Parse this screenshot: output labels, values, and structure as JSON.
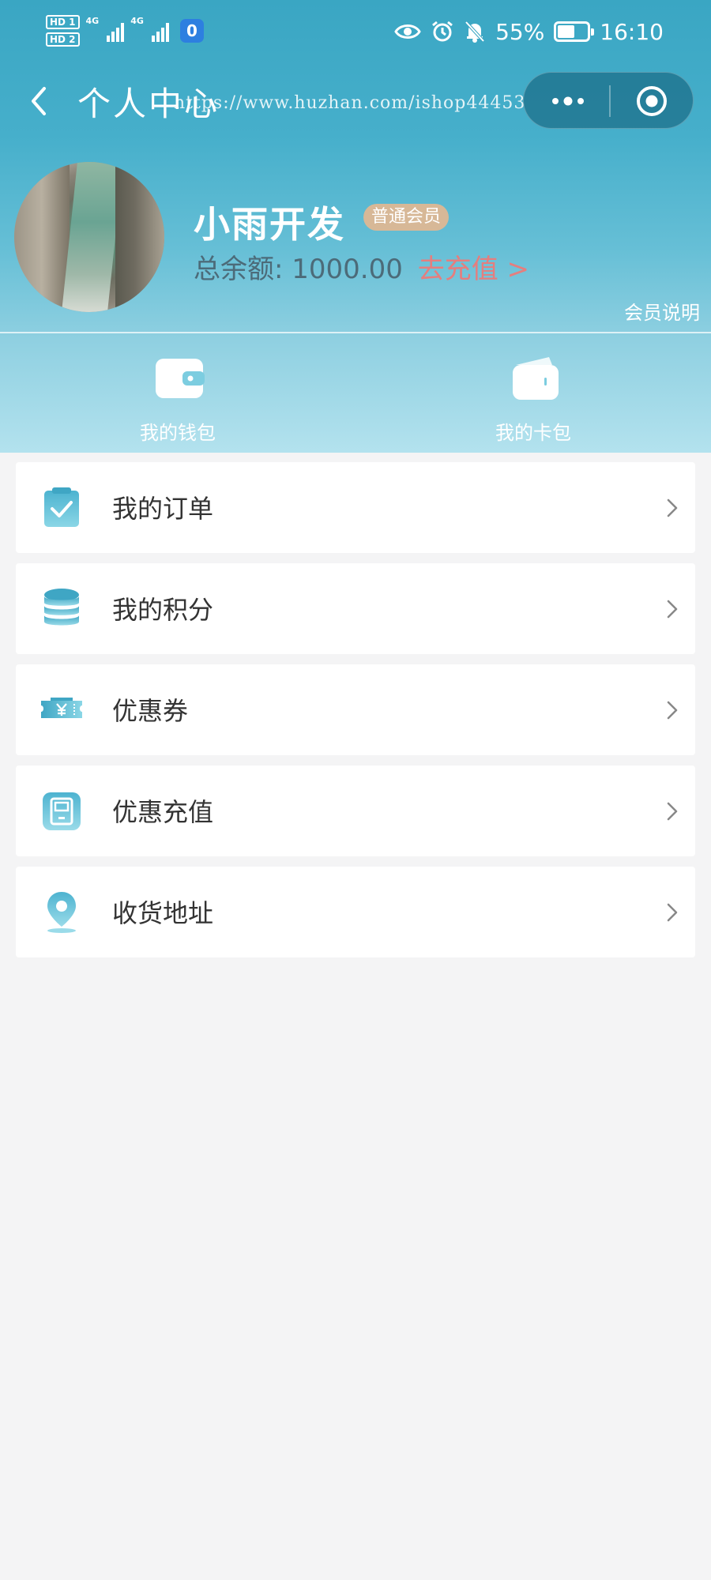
{
  "status_bar": {
    "sim1": "HD 1",
    "sim2": "HD 2",
    "net1": "4G",
    "net2": "4G",
    "app_badge": "0",
    "battery_percent": "55%",
    "battery_level": 0.55,
    "time": "16:10",
    "icons": [
      "eye-icon",
      "alarm-icon",
      "bell-muted-icon",
      "battery-icon"
    ]
  },
  "nav": {
    "title": "个人中心",
    "watermark": "https://www.huzhan.com/ishop44453",
    "back_icon": "chevron-left-icon",
    "more_icon": "more-dots-icon",
    "close_icon": "target-circle-icon"
  },
  "profile": {
    "username": "小雨开发",
    "member_level": "普通会员",
    "balance_label": "总余额:",
    "balance_value": "1000.00",
    "recharge_link": "去充值 >",
    "member_desc": "会员说明"
  },
  "quick_actions": [
    {
      "label": "我的钱包",
      "icon": "wallet-icon"
    },
    {
      "label": "我的卡包",
      "icon": "card-wallet-icon"
    }
  ],
  "menu": [
    {
      "label": "我的订单",
      "icon": "order-checklist-icon"
    },
    {
      "label": "我的积分",
      "icon": "coins-stack-icon"
    },
    {
      "label": "优惠券",
      "icon": "coupon-yen-icon"
    },
    {
      "label": "优惠充值",
      "icon": "recharge-device-icon"
    },
    {
      "label": "收货地址",
      "icon": "location-pin-icon"
    }
  ],
  "colors": {
    "header_top": "#3aa6c3",
    "header_bottom": "#b3e2ee",
    "accent_icon": "#5fbfd6",
    "recharge_link": "#e57e7e",
    "badge_bg": "#d7b897",
    "page_bg": "#f4f4f5"
  }
}
